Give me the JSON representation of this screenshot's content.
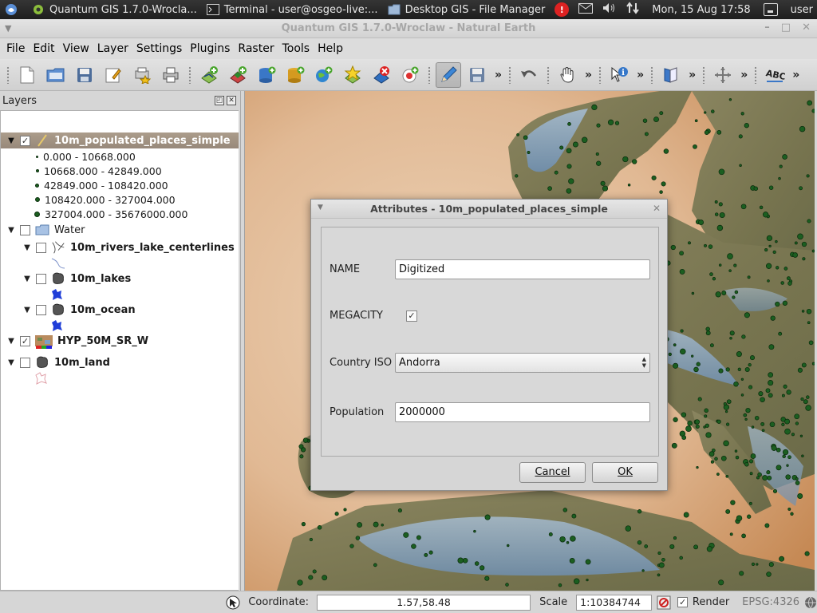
{
  "top_panel": {
    "apps": [
      {
        "label": "Quantum GIS 1.7.0-Wrocla...",
        "icon": "qgis-icon"
      },
      {
        "label": "Terminal - user@osgeo-live:...",
        "icon": "terminal-icon"
      },
      {
        "label": "Desktop GIS - File Manager",
        "icon": "folder-icon"
      }
    ],
    "datetime": "Mon, 15 Aug  17:58",
    "user": "user",
    "update_badge": "!"
  },
  "window": {
    "title": "Quantum GIS 1.7.0-Wroclaw - Natural Earth"
  },
  "menubar": [
    {
      "label": "File"
    },
    {
      "label": "Edit"
    },
    {
      "label": "View"
    },
    {
      "label": "Layer"
    },
    {
      "label": "Settings"
    },
    {
      "label": "Plugins"
    },
    {
      "label": "Raster"
    },
    {
      "label": "Tools"
    },
    {
      "label": "Help"
    }
  ],
  "layers_panel": {
    "title": "Layers",
    "layer1": {
      "name": "10m_populated_places_simple",
      "checked": true
    },
    "legend": [
      "0.000 - 10668.000",
      "10668.000 - 42849.000",
      "42849.000 - 108420.000",
      "108420.000 - 327004.000",
      "327004.000 - 35676000.000"
    ],
    "group_water": "Water",
    "rivers": "10m_rivers_lake_centerlines",
    "lakes": "10m_lakes",
    "ocean": "10m_ocean",
    "hyp": "HYP_50M_SR_W",
    "land": "10m_land"
  },
  "dialog": {
    "title": "Attributes - 10m_populated_places_simple",
    "fields": {
      "name_label": "NAME",
      "name_value": "Digitized",
      "megacity_label": "MEGACITY",
      "megacity_checked": true,
      "country_label": "Country ISO",
      "country_value": "Andorra",
      "population_label": "Population",
      "population_value": "2000000"
    },
    "cancel_label": "Cancel",
    "ok_label": "OK"
  },
  "statusbar": {
    "coordinate_label": "Coordinate:",
    "coordinate_value": "1.57,58.48",
    "scale_label": "Scale",
    "scale_value": "1:10384744",
    "render_label": "Render",
    "render_checked": true,
    "crs": "EPSG:4326"
  },
  "colors": {
    "land_light": "#eccfb2",
    "sea_dark": "#c68a58",
    "terrain_green": "#7d7a55",
    "terrain_blue": "#6f8fb0",
    "point_green": "#1b5e20"
  }
}
